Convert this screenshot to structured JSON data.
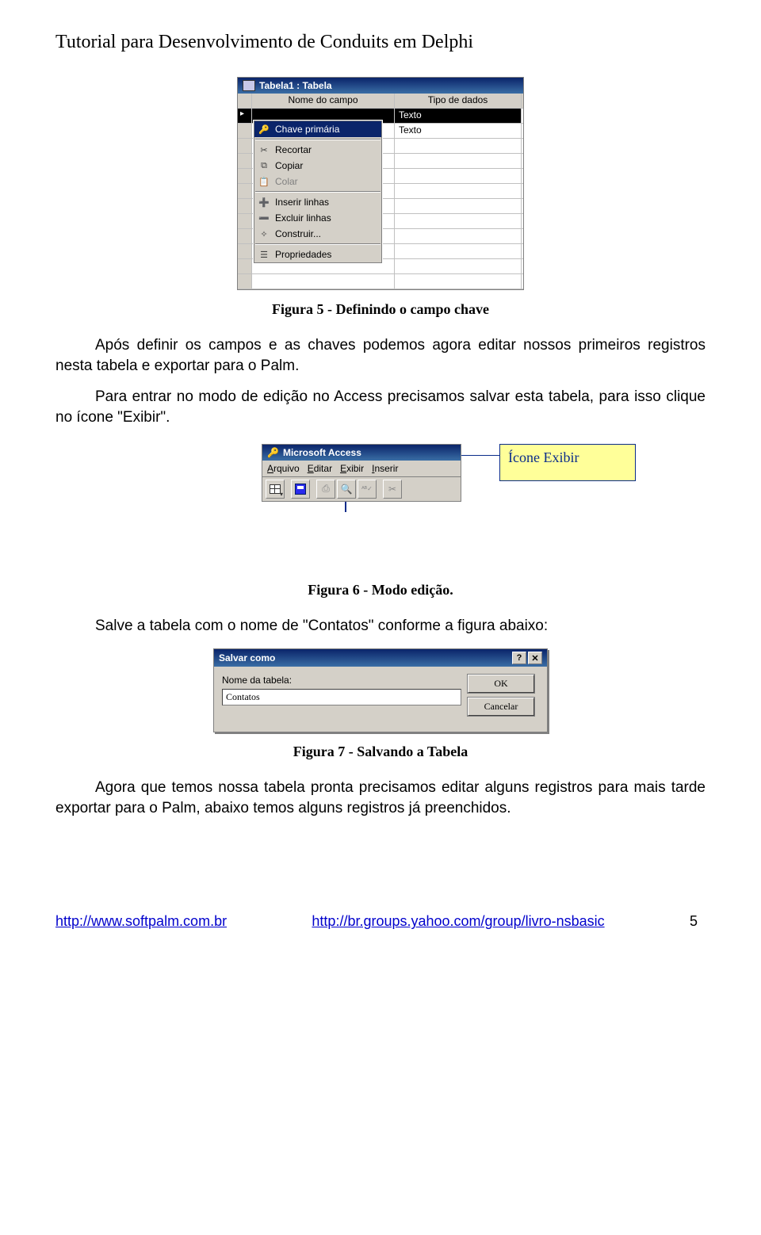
{
  "header": {
    "title": "Tutorial para Desenvolvimento de Conduits em Delphi"
  },
  "fig5": {
    "caption": "Figura 5 - Definindo o campo chave",
    "window_title": "Tabela1 : Tabela",
    "col1": "Nome do campo",
    "col2": "Tipo de dados",
    "row1_type": "Texto",
    "row2_type": "Texto",
    "ctx": {
      "primary_key": "Chave primária",
      "cut": "Recortar",
      "copy": "Copiar",
      "paste": "Colar",
      "insert_rows": "Inserir linhas",
      "delete_rows": "Excluir linhas",
      "build": "Construir...",
      "properties": "Propriedades"
    }
  },
  "para1": "Após definir os campos e as chaves podemos agora editar nossos primeiros registros nesta tabela e exportar para o Palm.",
  "para2": "Para entrar no modo de edição no Access precisamos salvar esta tabela, para isso clique no ícone \"Exibir\".",
  "fig6": {
    "callout": "Ícone Exibir",
    "app_title": "Microsoft Access",
    "menus": {
      "m1": "Arquivo",
      "m2": "Editar",
      "m3": "Exibir",
      "m4": "Inserir"
    },
    "caption": "Figura 6 - Modo edição."
  },
  "para3": "Salve a tabela com o nome de \"Contatos\" conforme a figura abaixo:",
  "fig7": {
    "title": "Salvar como",
    "label": "Nome da tabela:",
    "value": "Contatos",
    "ok": "OK",
    "cancel": "Cancelar",
    "caption": "Figura 7 - Salvando a Tabela"
  },
  "para4": "Agora que temos nossa tabela pronta precisamos editar alguns registros para mais tarde exportar para o Palm, abaixo temos alguns registros já preenchidos.",
  "footer": {
    "url1": "http://www.softpalm.com.br",
    "url2": "http://br.groups.yahoo.com/group/livro-nsbasic",
    "page": "5"
  }
}
